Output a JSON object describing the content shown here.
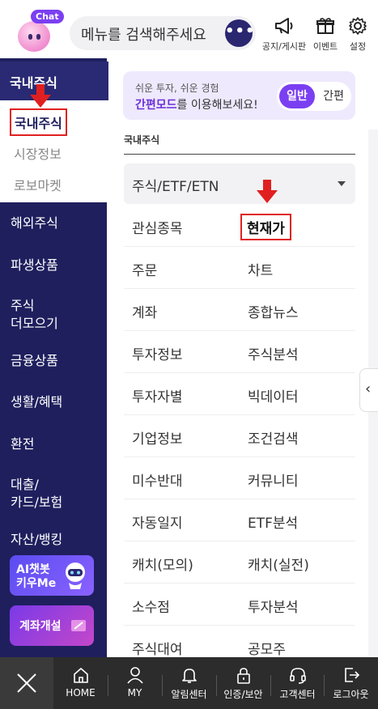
{
  "header": {
    "chat_badge": "Chat",
    "search_placeholder": "메뉴를 검색해주세요",
    "more_label": "•••",
    "icons": [
      {
        "name": "notice",
        "label": "공지/게시판"
      },
      {
        "name": "event",
        "label": "이벤트"
      },
      {
        "name": "settings",
        "label": "설정"
      }
    ]
  },
  "sidebar": {
    "active_category": "국내주식",
    "sub_items": [
      "국내주식",
      "시장정보",
      "로보마켓"
    ],
    "categories": [
      "해외주식",
      "파생상품",
      "주식\n더모으기",
      "금융상품",
      "생활/혜택",
      "환전",
      "대출/\n카드/보험",
      "자산/뱅킹"
    ],
    "ai_button": "AI챗봇\n키우Me",
    "account_button": "계좌개설"
  },
  "mode_banner": {
    "small_text": "쉬운 투자, 쉬운 경험",
    "highlight": "간편모드",
    "rest_text": "를 이용해보세요!",
    "toggle_on": "일반",
    "toggle_off": "간편"
  },
  "section_title": "국내주식",
  "dropdown_label": "주식/ETF/ETN",
  "menu_rows": [
    [
      "관심종목",
      "현재가"
    ],
    [
      "주문",
      "차트"
    ],
    [
      "계좌",
      "종합뉴스"
    ],
    [
      "투자정보",
      "주식분석"
    ],
    [
      "투자자별",
      "빅데이터"
    ],
    [
      "기업정보",
      "조건검색"
    ],
    [
      "미수반대",
      "커뮤니티"
    ],
    [
      "자동일지",
      "ETF분석"
    ],
    [
      "캐치(모의)",
      "캐치(실전)"
    ],
    [
      "소수점",
      "투자분석"
    ],
    [
      "주식대여",
      "공모주"
    ]
  ],
  "highlighted_menu": "현재가",
  "edge_tab": "‹",
  "bottom_bar": [
    {
      "name": "home",
      "label": "HOME"
    },
    {
      "name": "my",
      "label": "MY"
    },
    {
      "name": "alarm",
      "label": "알림센터"
    },
    {
      "name": "auth",
      "label": "인증/보안"
    },
    {
      "name": "customer",
      "label": "고객센터"
    },
    {
      "name": "logout",
      "label": "로그아웃"
    }
  ],
  "colors": {
    "sidebar_bg": "#1f1f5e",
    "accent_purple": "#7b3ff2",
    "highlight_red": "#e02020",
    "bottom_bar_bg": "#2c2c2c"
  }
}
